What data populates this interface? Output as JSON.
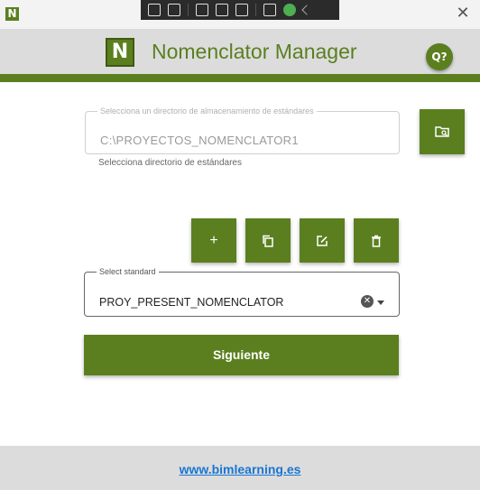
{
  "window": {
    "app_icon_letter": "N",
    "close_glyph": "✕"
  },
  "header": {
    "logo_letter": "N",
    "title": "Nomenclator Manager",
    "help_label": "Q?"
  },
  "directory": {
    "legend": "Selecciona un directorio de almacenamiento de estándares",
    "value": "C:\\PROYECTOS_NOMENCLATOR1",
    "helper": "Selecciona directorio de estándares"
  },
  "actions": {
    "add_glyph": "+"
  },
  "standard": {
    "legend": "Select standard",
    "value": "PROY_PRESENT_NOMENCLATOR",
    "clear_glyph": "✕"
  },
  "next_button": {
    "label": "Siguiente"
  },
  "footer": {
    "link": "www.bimlearning.es"
  },
  "colors": {
    "brand_green": "#5b7f1f",
    "header_bg": "#dcdcdc",
    "link_blue": "#1976d2"
  },
  "icons": {
    "browse": "folder-search-icon",
    "add": "plus-icon",
    "duplicate": "copy-icon",
    "edit": "edit-icon",
    "delete": "trash-icon",
    "help": "lightbulb-question-icon"
  }
}
